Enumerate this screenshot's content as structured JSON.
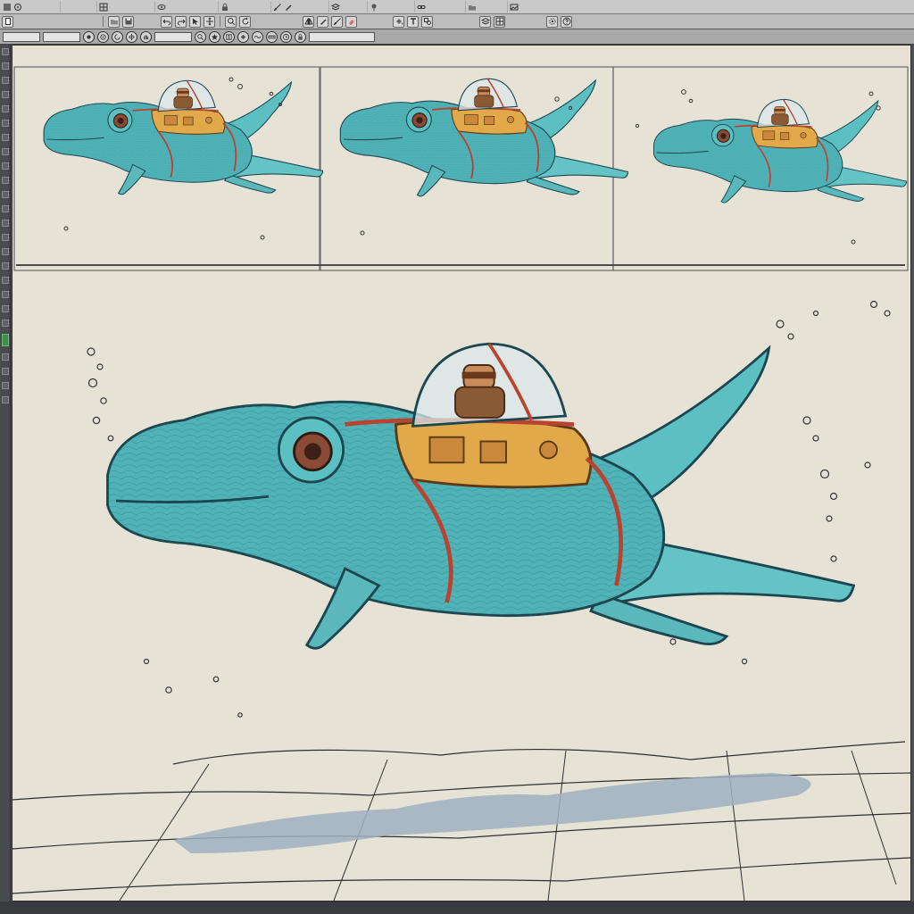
{
  "app": {
    "menu_icons": [
      "app-icon",
      "gear-icon",
      "grid-icon",
      "eye-icon",
      "lock-icon",
      "brush-icon",
      "pencil-icon",
      "layers-icon",
      "pin-icon",
      "link-icon",
      "folder-icon",
      "image-icon"
    ],
    "toolbar_icons": [
      "new-icon",
      "open-icon",
      "save-icon",
      "undo-icon",
      "redo-icon",
      "select-icon",
      "move-icon",
      "zoom-icon",
      "rotate-icon",
      "flip-icon",
      "pencil-icon",
      "brush-icon",
      "eraser-icon",
      "fill-icon",
      "text-icon",
      "shape-icon",
      "layer-icon",
      "grid-icon",
      "settings-icon",
      "help-icon"
    ],
    "option_icons": [
      "brush-preset-icon",
      "target-icon",
      "refresh-icon",
      "mirror-icon",
      "hand-icon",
      "zoom-icon",
      "star-icon",
      "snap-icon",
      "fill-icon",
      "stabilizer-icon",
      "ruler-icon",
      "clock-icon",
      "lock-icon"
    ]
  },
  "canvas": {
    "background": "#e6e3d6",
    "accent": "#4fb3b8",
    "harness": "#b8432f",
    "saddle": "#e1a94a",
    "shadow": "#9fb0c0",
    "tool_active_color": "#3f8f4a"
  }
}
